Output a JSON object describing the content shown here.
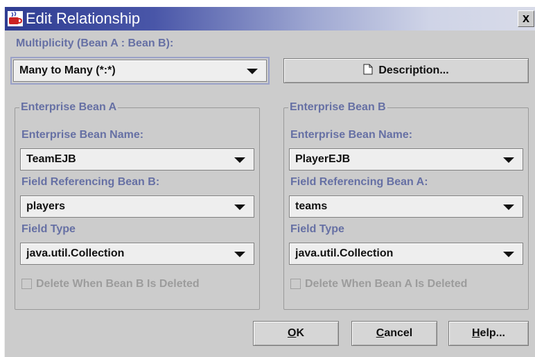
{
  "window": {
    "title": "Edit Relationship",
    "close_label": "x"
  },
  "multiplicity": {
    "label": "Multiplicity (Bean A : Bean B):",
    "value": "Many to Many (*:*)"
  },
  "description_button": {
    "label": "Description..."
  },
  "bean_a": {
    "legend": "Enterprise Bean A",
    "name_label": "Enterprise Bean Name:",
    "name_value": "TeamEJB",
    "field_label": "Field Referencing Bean B:",
    "field_value": "players",
    "type_label": "Field Type",
    "type_value": "java.util.Collection",
    "delete_label": "Delete When Bean B Is Deleted"
  },
  "bean_b": {
    "legend": "Enterprise Bean B",
    "name_label": "Enterprise Bean Name:",
    "name_value": "PlayerEJB",
    "field_label": "Field Referencing Bean A:",
    "field_value": "teams",
    "type_label": "Field Type",
    "type_value": "java.util.Collection",
    "delete_label": "Delete When Bean A Is Deleted"
  },
  "buttons": {
    "ok": {
      "mnemonic": "O",
      "rest": "K"
    },
    "cancel": {
      "mnemonic": "C",
      "rest": "ancel"
    },
    "help": {
      "mnemonic": "H",
      "rest": "elp..."
    }
  },
  "colors": {
    "label": "#6670a4",
    "titlebar": "#2f3d92",
    "disabled": "#9c9c9c",
    "background": "#cccccc"
  },
  "icons": {
    "app": "java-coffee-cup-icon",
    "description": "document-icon",
    "close": "close-icon"
  }
}
